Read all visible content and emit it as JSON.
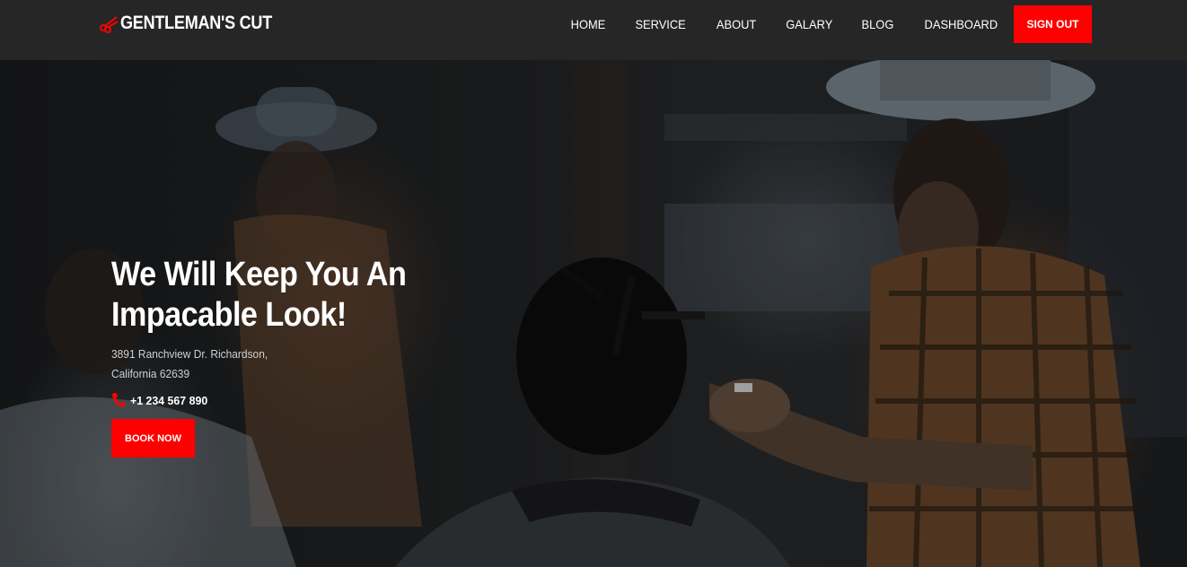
{
  "brand": {
    "name": "GENTLEMAN'S CUT",
    "logo_icon": "scissors-icon",
    "accent_color": "#ff0000"
  },
  "nav": {
    "links": [
      "HOME",
      "SERVICE",
      "ABOUT",
      "GALARY",
      "BLOG",
      "DASHBOARD"
    ],
    "signout_label": "SIGN OUT"
  },
  "hero": {
    "title_line1": "We Will Keep You An",
    "title_line2": "Impacable Look!",
    "address_line1": "3891 Ranchview Dr. Richardson,",
    "address_line2": "California 62639",
    "phone_icon": "phone-icon",
    "phone": "+1 234 567 890",
    "book_label": "BOOK NOW",
    "background": "barbershop-photo"
  },
  "colors": {
    "navbar_bg": "#262626",
    "button_red": "#ff0000",
    "text_white": "#ffffff"
  }
}
